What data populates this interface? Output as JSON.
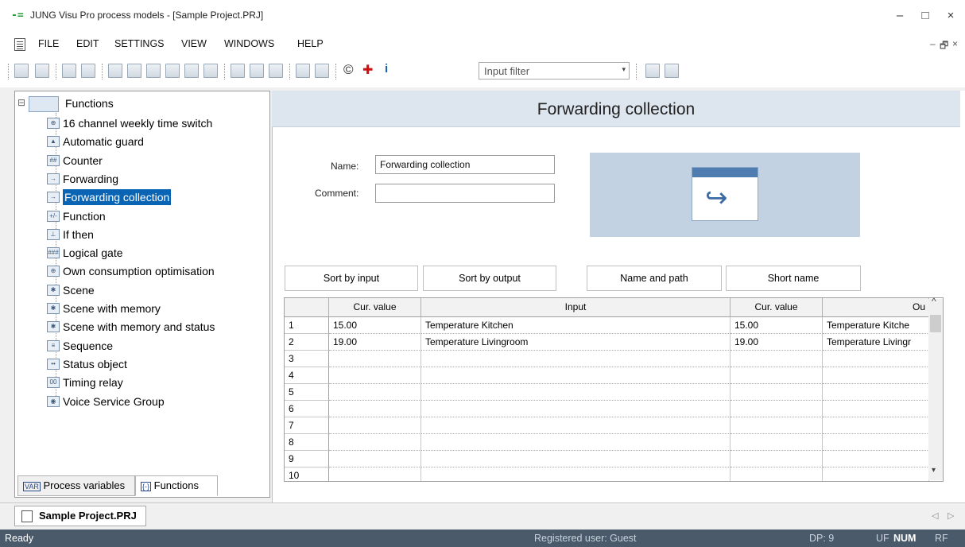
{
  "window": {
    "title": "JUNG Visu Pro process models - [Sample Project.PRJ]",
    "app_icon": "-=",
    "minimize": "–",
    "maximize": "□",
    "close": "×"
  },
  "menu": {
    "items": [
      "FILE",
      "EDIT",
      "SETTINGS",
      "VIEW",
      "WINDOWS",
      "HELP"
    ],
    "mdi_min": "–",
    "mdi_restore": "🗗",
    "mdi_close": "×"
  },
  "toolbar": {
    "input_filter_value": "Input filter",
    "dropdown_arrow": "▾",
    "copyright_icon": "©",
    "plus_icon": "✚",
    "info_icon": "i"
  },
  "tree": {
    "root_label": "Functions",
    "root_toggle": "⊟",
    "items": [
      {
        "label": "16 channel weekly time switch",
        "icon": "clock-icon",
        "glyph": "⊕"
      },
      {
        "label": "Automatic guard",
        "icon": "warning-icon",
        "glyph": "▲"
      },
      {
        "label": "Counter",
        "icon": "counter-icon",
        "glyph": "##"
      },
      {
        "label": "Forwarding",
        "icon": "forwarding-icon",
        "glyph": "→"
      },
      {
        "label": "Forwarding collection",
        "icon": "forwarding-icon",
        "glyph": "→"
      },
      {
        "label": "Function",
        "icon": "function-icon",
        "glyph": "+/-"
      },
      {
        "label": "If then",
        "icon": "if-then-icon",
        "glyph": "⊥"
      },
      {
        "label": "Logical gate",
        "icon": "gate-icon",
        "glyph": "###"
      },
      {
        "label": "Own consumption optimisation",
        "icon": "clock-icon",
        "glyph": "⊕"
      },
      {
        "label": "Scene",
        "icon": "scene-icon",
        "glyph": "✱"
      },
      {
        "label": "Scene with memory",
        "icon": "scene-memory-icon",
        "glyph": "✱"
      },
      {
        "label": "Scene with memory and status",
        "icon": "scene-memory-icon",
        "glyph": "✱"
      },
      {
        "label": "Sequence",
        "icon": "sequence-icon",
        "glyph": "≡"
      },
      {
        "label": "Status object",
        "icon": "status-icon",
        "glyph": "••"
      },
      {
        "label": "Timing relay",
        "icon": "timer-icon",
        "glyph": "00"
      },
      {
        "label": "Voice Service Group",
        "icon": "voice-icon",
        "glyph": "◉"
      }
    ],
    "selected_index": 4
  },
  "left_tabs": [
    {
      "label": "Process variables",
      "icon_text": "VAR"
    },
    {
      "label": "Functions",
      "icon_text": "{-}"
    }
  ],
  "panel": {
    "title": "Forwarding collection",
    "name_label": "Name:",
    "name_value": "Forwarding collection",
    "comment_label": "Comment:",
    "comment_value": ""
  },
  "sort_buttons": [
    "Sort by input",
    "Sort by output",
    "Name and path",
    "Short name"
  ],
  "grid": {
    "headers": [
      "",
      "Cur. value",
      "Input",
      "Cur. value",
      "Ou"
    ],
    "rows": [
      [
        "1",
        "15.00",
        "Temperature Kitchen",
        "15.00",
        "Temperature Kitche"
      ],
      [
        "2",
        "19.00",
        "Temperature Livingroom",
        "19.00",
        "Temperature Livingr"
      ],
      [
        "3",
        "",
        "",
        "",
        ""
      ],
      [
        "4",
        "",
        "",
        "",
        ""
      ],
      [
        "5",
        "",
        "",
        "",
        ""
      ],
      [
        "6",
        "",
        "",
        "",
        ""
      ],
      [
        "7",
        "",
        "",
        "",
        ""
      ],
      [
        "8",
        "",
        "",
        "",
        ""
      ],
      [
        "9",
        "",
        "",
        "",
        ""
      ],
      [
        "10",
        "",
        "",
        "",
        ""
      ]
    ],
    "scroll_up": "^",
    "scroll_down": "▾"
  },
  "doc_tab": {
    "label": "Sample Project.PRJ",
    "nav_left": "◁",
    "nav_right": "▷"
  },
  "status": {
    "ready": "Ready",
    "user": "Registered user: Guest",
    "dp": "DP: 9",
    "uf": "UF",
    "num": "NUM",
    "rf": "RF"
  }
}
